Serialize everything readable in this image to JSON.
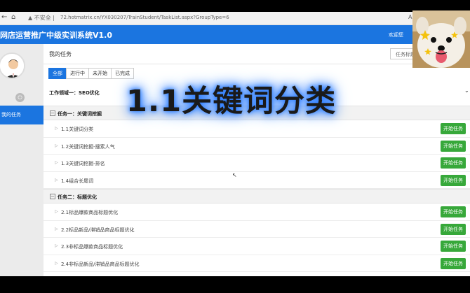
{
  "browser": {
    "security_label": "不安全",
    "url": "72.hotmatrix.cn/YX030207/TrainStudent/TaskList.aspx?GroupType=6",
    "reader_label": "A"
  },
  "app": {
    "title": "网店运营推广中级实训系统V1.0",
    "welcome": "欢迎您"
  },
  "sidebar": {
    "active_item": "我的任务"
  },
  "main": {
    "title": "我的任务",
    "search_placeholder": "任务标题",
    "tabs": [
      "全部",
      "进行中",
      "未开始",
      "已完成"
    ],
    "active_tab": 0,
    "field_label": "工作领域一：SEO优化",
    "start_label": "开始任务",
    "groups": [
      {
        "name": "任务一：关键词挖掘",
        "tasks": [
          "1.1关键词分类",
          "1.2关键词挖掘-搜索人气",
          "1.3关键词挖掘-排名",
          "1.4组合长尾词"
        ]
      },
      {
        "name": "任务二：标题优化",
        "tasks": [
          "2.1标品爆款商品标题优化",
          "2.2标品新品/滞销品商品标题优化",
          "2.3非标品爆款商品标题优化",
          "2.4非标品新品/滞销品商品标题优化"
        ]
      }
    ]
  },
  "overlay": {
    "caption": "1.1关键词分类"
  },
  "colors": {
    "primary": "#1b75e0",
    "start_button": "#37a83a",
    "caption_glow": "#2f7fff"
  }
}
